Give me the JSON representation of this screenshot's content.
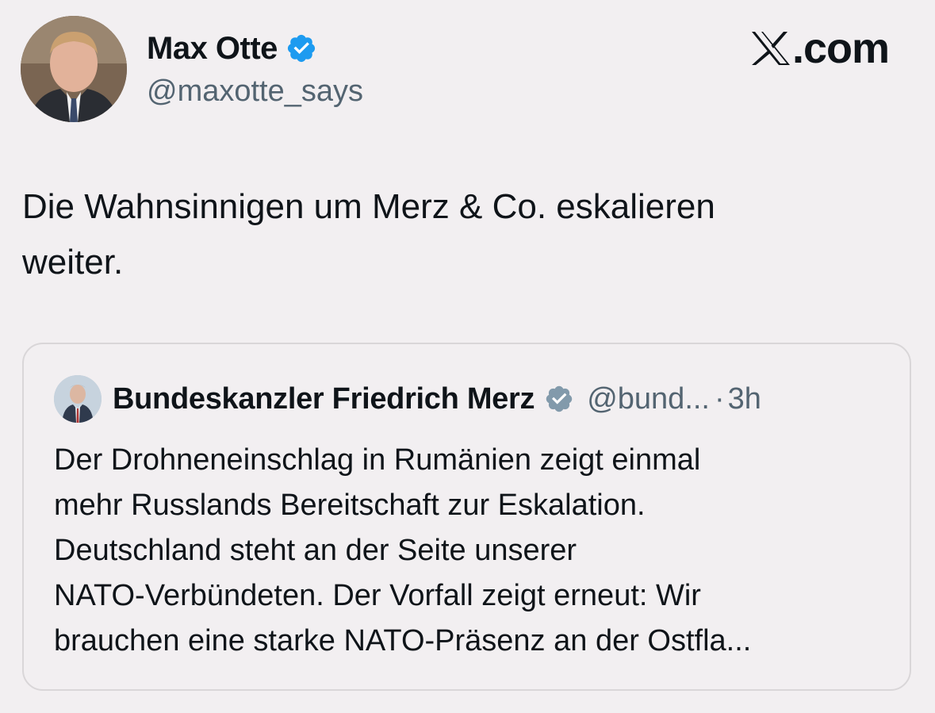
{
  "author": {
    "name": "Max Otte",
    "handle": "@maxotte_says",
    "verified_icon": "verified-badge-icon",
    "verified_color": "#1d9bf0"
  },
  "brand": {
    "text": ".com",
    "icon": "x-logo-icon"
  },
  "tweet": {
    "line1": "Die Wahnsinnigen um Merz & Co. eskalieren",
    "line2": "weiter."
  },
  "quote": {
    "name": "Bundeskanzler Friedrich Merz",
    "verified_icon": "verified-gray-badge-icon",
    "verified_color": "#829aab",
    "handle": "@bund...",
    "separator": "·",
    "time": "3h",
    "lines": [
      "Der Drohneneinschlag in Rumänien zeigt einmal",
      "mehr Russlands Bereitschaft zur Eskalation.",
      "Deutschland steht an der Seite unserer",
      "NATO-Verbündeten. Der Vorfall zeigt erneut: Wir",
      "brauchen eine starke NATO-Präsenz an der Ostfla..."
    ]
  },
  "colors": {
    "background": "#f2eff1",
    "text": "#0f1419",
    "secondary_text": "#536471",
    "border": "#d9d6d8"
  }
}
